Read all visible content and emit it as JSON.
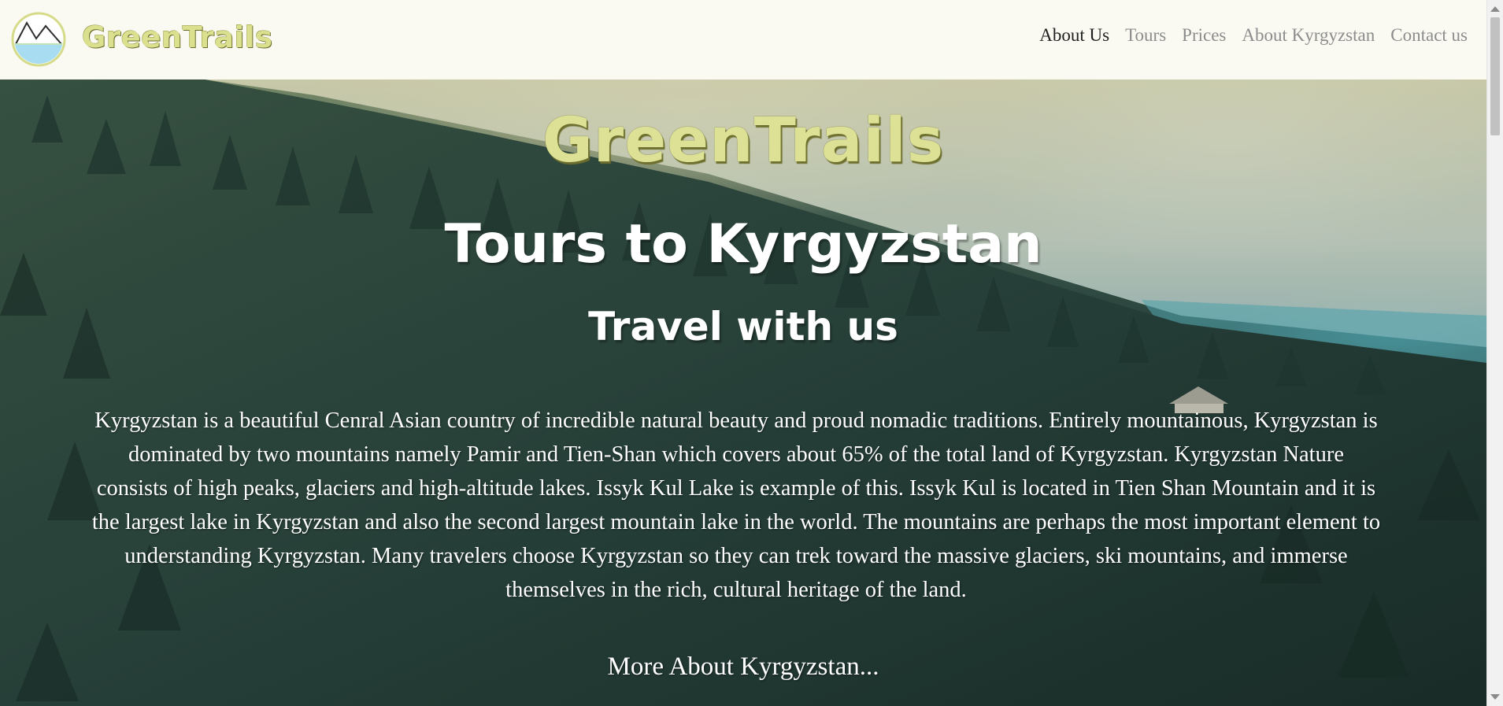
{
  "header": {
    "logo_icon": "mountain-lake-logo-icon",
    "brand": "GreenTrails",
    "nav": [
      {
        "label": "About Us",
        "active": true
      },
      {
        "label": "Tours",
        "active": false
      },
      {
        "label": "Prices",
        "active": false
      },
      {
        "label": "About Kyrgyzstan",
        "active": false
      },
      {
        "label": "Contact us",
        "active": false
      }
    ]
  },
  "hero": {
    "brand": "GreenTrails",
    "title": "Tours to Kyrgyzstan",
    "subtitle": "Travel with us",
    "paragraph": "Kyrgyzstan is a beautiful Cenral Asian country of incredible natural beauty and proud nomadic traditions. Entirely mountainous, Kyrgyzstan is dominated by two mountains namely Pamir and Tien-Shan which covers about 65% of the total land of Kyrgyzstan. Kyrgyzstan Nature consists of high peaks, glaciers and high-altitude lakes. Issyk Kul Lake is example of this. Issyk Kul is located in Tien Shan Mountain and it is the largest lake in Kyrgyzstan and also the second largest mountain lake in the world. The mountains are perhaps the most important element to understanding Kyrgyzstan. Many travelers choose Kyrgyzstan so they can trek toward the massive glaciers, ski mountains, and immerse themselves in the rich, cultural heritage of the land.",
    "more_link": "More About Kyrgyzstan..."
  },
  "colors": {
    "header_bg": "#fafaf2",
    "brand_green": "#dde195",
    "nav_active": "#1f1f1f",
    "nav_inactive": "#8c8c8c",
    "logo_sky": "#a8dcf0"
  }
}
